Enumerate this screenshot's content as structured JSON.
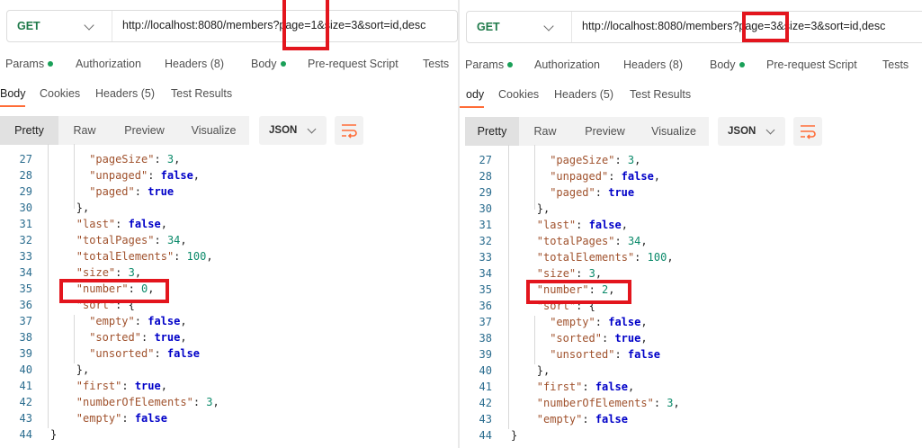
{
  "panels": {
    "left": {
      "method": "GET",
      "url": "http://localhost:8080/members?page=1&size=3&sort=id,desc",
      "request_tabs": [
        "Params",
        "Authorization",
        "Headers (8)",
        "Body",
        "Pre-request Script",
        "Tests"
      ],
      "response_tabs": [
        "Body",
        "Cookies",
        "Headers (5)",
        "Test Results"
      ],
      "view_modes": [
        "Pretty",
        "Raw",
        "Preview",
        "Visualize"
      ],
      "format": "JSON",
      "code_lines": [
        {
          "n": "27",
          "indent": 3,
          "parts": [
            [
              "k",
              "\"pageSize\""
            ],
            [
              "p",
              ": "
            ],
            [
              "num",
              "3"
            ],
            [
              "p",
              ","
            ]
          ]
        },
        {
          "n": "28",
          "indent": 3,
          "parts": [
            [
              "k",
              "\"unpaged\""
            ],
            [
              "p",
              ": "
            ],
            [
              "kw",
              "false"
            ],
            [
              "p",
              ","
            ]
          ]
        },
        {
          "n": "29",
          "indent": 3,
          "parts": [
            [
              "k",
              "\"paged\""
            ],
            [
              "p",
              ": "
            ],
            [
              "kw",
              "true"
            ]
          ]
        },
        {
          "n": "30",
          "indent": 2,
          "parts": [
            [
              "p",
              "},"
            ]
          ]
        },
        {
          "n": "31",
          "indent": 2,
          "parts": [
            [
              "k",
              "\"last\""
            ],
            [
              "p",
              ": "
            ],
            [
              "kw",
              "false"
            ],
            [
              "p",
              ","
            ]
          ]
        },
        {
          "n": "32",
          "indent": 2,
          "parts": [
            [
              "k",
              "\"totalPages\""
            ],
            [
              "p",
              ": "
            ],
            [
              "num",
              "34"
            ],
            [
              "p",
              ","
            ]
          ]
        },
        {
          "n": "33",
          "indent": 2,
          "parts": [
            [
              "k",
              "\"totalElements\""
            ],
            [
              "p",
              ": "
            ],
            [
              "num",
              "100"
            ],
            [
              "p",
              ","
            ]
          ]
        },
        {
          "n": "34",
          "indent": 2,
          "parts": [
            [
              "k",
              "\"size\""
            ],
            [
              "p",
              ": "
            ],
            [
              "num",
              "3"
            ],
            [
              "p",
              ","
            ]
          ]
        },
        {
          "n": "35",
          "indent": 2,
          "parts": [
            [
              "k",
              "\"number\""
            ],
            [
              "p",
              ": "
            ],
            [
              "num",
              "0"
            ],
            [
              "p",
              ","
            ]
          ]
        },
        {
          "n": "36",
          "indent": 2,
          "parts": [
            [
              "k",
              "\"sort\""
            ],
            [
              "p",
              ": {"
            ]
          ]
        },
        {
          "n": "37",
          "indent": 3,
          "parts": [
            [
              "k",
              "\"empty\""
            ],
            [
              "p",
              ": "
            ],
            [
              "kw",
              "false"
            ],
            [
              "p",
              ","
            ]
          ]
        },
        {
          "n": "38",
          "indent": 3,
          "parts": [
            [
              "k",
              "\"sorted\""
            ],
            [
              "p",
              ": "
            ],
            [
              "kw",
              "true"
            ],
            [
              "p",
              ","
            ]
          ]
        },
        {
          "n": "39",
          "indent": 3,
          "parts": [
            [
              "k",
              "\"unsorted\""
            ],
            [
              "p",
              ": "
            ],
            [
              "kw",
              "false"
            ]
          ]
        },
        {
          "n": "40",
          "indent": 2,
          "parts": [
            [
              "p",
              "},"
            ]
          ]
        },
        {
          "n": "41",
          "indent": 2,
          "parts": [
            [
              "k",
              "\"first\""
            ],
            [
              "p",
              ": "
            ],
            [
              "kw",
              "true"
            ],
            [
              "p",
              ","
            ]
          ]
        },
        {
          "n": "42",
          "indent": 2,
          "parts": [
            [
              "k",
              "\"numberOfElements\""
            ],
            [
              "p",
              ": "
            ],
            [
              "num",
              "3"
            ],
            [
              "p",
              ","
            ]
          ]
        },
        {
          "n": "43",
          "indent": 2,
          "parts": [
            [
              "k",
              "\"empty\""
            ],
            [
              "p",
              ": "
            ],
            [
              "kw",
              "false"
            ]
          ]
        },
        {
          "n": "44",
          "indent": 0,
          "parts": [
            [
              "p",
              "}"
            ]
          ]
        }
      ]
    },
    "right": {
      "method": "GET",
      "url": "http://localhost:8080/members?page=3&size=3&sort=id,desc",
      "request_tabs": [
        "Params",
        "Authorization",
        "Headers (8)",
        "Body",
        "Pre-request Script",
        "Tests"
      ],
      "response_tabs": [
        "ody",
        "Cookies",
        "Headers (5)",
        "Test Results"
      ],
      "view_modes": [
        "Pretty",
        "Raw",
        "Preview",
        "Visualize"
      ],
      "format": "JSON",
      "code_lines": [
        {
          "n": "27",
          "indent": 3,
          "parts": [
            [
              "k",
              "\"pageSize\""
            ],
            [
              "p",
              ": "
            ],
            [
              "num",
              "3"
            ],
            [
              "p",
              ","
            ]
          ]
        },
        {
          "n": "28",
          "indent": 3,
          "parts": [
            [
              "k",
              "\"unpaged\""
            ],
            [
              "p",
              ": "
            ],
            [
              "kw",
              "false"
            ],
            [
              "p",
              ","
            ]
          ]
        },
        {
          "n": "29",
          "indent": 3,
          "parts": [
            [
              "k",
              "\"paged\""
            ],
            [
              "p",
              ": "
            ],
            [
              "kw",
              "true"
            ]
          ]
        },
        {
          "n": "30",
          "indent": 2,
          "parts": [
            [
              "p",
              "},"
            ]
          ]
        },
        {
          "n": "31",
          "indent": 2,
          "parts": [
            [
              "k",
              "\"last\""
            ],
            [
              "p",
              ": "
            ],
            [
              "kw",
              "false"
            ],
            [
              "p",
              ","
            ]
          ]
        },
        {
          "n": "32",
          "indent": 2,
          "parts": [
            [
              "k",
              "\"totalPages\""
            ],
            [
              "p",
              ": "
            ],
            [
              "num",
              "34"
            ],
            [
              "p",
              ","
            ]
          ]
        },
        {
          "n": "33",
          "indent": 2,
          "parts": [
            [
              "k",
              "\"totalElements\""
            ],
            [
              "p",
              ": "
            ],
            [
              "num",
              "100"
            ],
            [
              "p",
              ","
            ]
          ]
        },
        {
          "n": "34",
          "indent": 2,
          "parts": [
            [
              "k",
              "\"size\""
            ],
            [
              "p",
              ": "
            ],
            [
              "num",
              "3"
            ],
            [
              "p",
              ","
            ]
          ]
        },
        {
          "n": "35",
          "indent": 2,
          "parts": [
            [
              "k",
              "\"number\""
            ],
            [
              "p",
              ": "
            ],
            [
              "num",
              "2"
            ],
            [
              "p",
              ","
            ]
          ]
        },
        {
          "n": "36",
          "indent": 2,
          "parts": [
            [
              "k",
              "\"sort\""
            ],
            [
              "p",
              ": {"
            ]
          ]
        },
        {
          "n": "37",
          "indent": 3,
          "parts": [
            [
              "k",
              "\"empty\""
            ],
            [
              "p",
              ": "
            ],
            [
              "kw",
              "false"
            ],
            [
              "p",
              ","
            ]
          ]
        },
        {
          "n": "38",
          "indent": 3,
          "parts": [
            [
              "k",
              "\"sorted\""
            ],
            [
              "p",
              ": "
            ],
            [
              "kw",
              "true"
            ],
            [
              "p",
              ","
            ]
          ]
        },
        {
          "n": "39",
          "indent": 3,
          "parts": [
            [
              "k",
              "\"unsorted\""
            ],
            [
              "p",
              ": "
            ],
            [
              "kw",
              "false"
            ]
          ]
        },
        {
          "n": "40",
          "indent": 2,
          "parts": [
            [
              "p",
              "},"
            ]
          ]
        },
        {
          "n": "41",
          "indent": 2,
          "parts": [
            [
              "k",
              "\"first\""
            ],
            [
              "p",
              ": "
            ],
            [
              "kw",
              "false"
            ],
            [
              "p",
              ","
            ]
          ]
        },
        {
          "n": "42",
          "indent": 2,
          "parts": [
            [
              "k",
              "\"numberOfElements\""
            ],
            [
              "p",
              ": "
            ],
            [
              "num",
              "3"
            ],
            [
              "p",
              ","
            ]
          ]
        },
        {
          "n": "43",
          "indent": 2,
          "parts": [
            [
              "k",
              "\"empty\""
            ],
            [
              "p",
              ": "
            ],
            [
              "kw",
              "false"
            ]
          ]
        },
        {
          "n": "44",
          "indent": 0,
          "parts": [
            [
              "p",
              "}"
            ]
          ]
        }
      ]
    }
  },
  "colors": {
    "accent": "#ff6c37",
    "highlight": "#e3151d",
    "method": "#1f7a4a",
    "status_dot": "#1aa058"
  },
  "icons": {
    "method_dropdown": "chevron-down-icon",
    "format_dropdown": "chevron-down-icon",
    "wrap": "wrap-lines-icon"
  }
}
